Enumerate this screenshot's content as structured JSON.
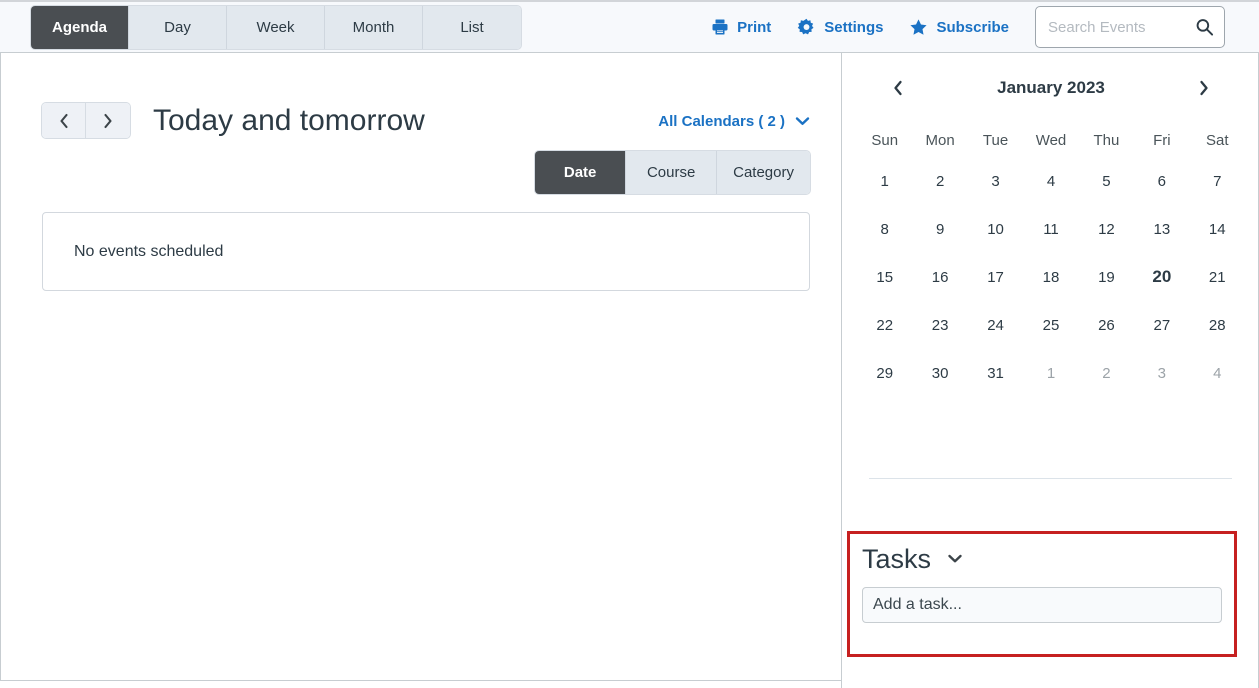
{
  "toolbar": {
    "view_tabs": [
      {
        "label": "Agenda",
        "active": true
      },
      {
        "label": "Day",
        "active": false
      },
      {
        "label": "Week",
        "active": false
      },
      {
        "label": "Month",
        "active": false
      },
      {
        "label": "List",
        "active": false
      }
    ],
    "actions": [
      {
        "label": "Print",
        "icon": "printer-icon"
      },
      {
        "label": "Settings",
        "icon": "gear-icon"
      },
      {
        "label": "Subscribe",
        "icon": "star-icon"
      }
    ],
    "search": {
      "placeholder": "Search Events",
      "value": "",
      "icon": "search-icon"
    }
  },
  "main": {
    "prev_label": "‹",
    "next_label": "›",
    "title": "Today and tomorrow",
    "calendars_link": "All Calendars ( 2 )",
    "filter_tabs": [
      {
        "label": "Date",
        "active": true
      },
      {
        "label": "Course",
        "active": false
      },
      {
        "label": "Category",
        "active": false
      }
    ],
    "empty_state": "No events scheduled"
  },
  "sidebar": {
    "mini_calendar": {
      "month_title": "January 2023",
      "prev_label": "‹",
      "next_label": "›",
      "weekdays": [
        "Sun",
        "Mon",
        "Tue",
        "Wed",
        "Thu",
        "Fri",
        "Sat"
      ],
      "days": [
        {
          "n": "1",
          "muted": false,
          "today": false
        },
        {
          "n": "2",
          "muted": false,
          "today": false
        },
        {
          "n": "3",
          "muted": false,
          "today": false
        },
        {
          "n": "4",
          "muted": false,
          "today": false
        },
        {
          "n": "5",
          "muted": false,
          "today": false
        },
        {
          "n": "6",
          "muted": false,
          "today": false
        },
        {
          "n": "7",
          "muted": false,
          "today": false
        },
        {
          "n": "8",
          "muted": false,
          "today": false
        },
        {
          "n": "9",
          "muted": false,
          "today": false
        },
        {
          "n": "10",
          "muted": false,
          "today": false
        },
        {
          "n": "11",
          "muted": false,
          "today": false
        },
        {
          "n": "12",
          "muted": false,
          "today": false
        },
        {
          "n": "13",
          "muted": false,
          "today": false
        },
        {
          "n": "14",
          "muted": false,
          "today": false
        },
        {
          "n": "15",
          "muted": false,
          "today": false
        },
        {
          "n": "16",
          "muted": false,
          "today": false
        },
        {
          "n": "17",
          "muted": false,
          "today": false
        },
        {
          "n": "18",
          "muted": false,
          "today": false
        },
        {
          "n": "19",
          "muted": false,
          "today": false
        },
        {
          "n": "20",
          "muted": false,
          "today": true
        },
        {
          "n": "21",
          "muted": false,
          "today": false
        },
        {
          "n": "22",
          "muted": false,
          "today": false
        },
        {
          "n": "23",
          "muted": false,
          "today": false
        },
        {
          "n": "24",
          "muted": false,
          "today": false
        },
        {
          "n": "25",
          "muted": false,
          "today": false
        },
        {
          "n": "26",
          "muted": false,
          "today": false
        },
        {
          "n": "27",
          "muted": false,
          "today": false
        },
        {
          "n": "28",
          "muted": false,
          "today": false
        },
        {
          "n": "29",
          "muted": false,
          "today": false
        },
        {
          "n": "30",
          "muted": false,
          "today": false
        },
        {
          "n": "31",
          "muted": false,
          "today": false
        },
        {
          "n": "1",
          "muted": true,
          "today": false
        },
        {
          "n": "2",
          "muted": true,
          "today": false
        },
        {
          "n": "3",
          "muted": true,
          "today": false
        },
        {
          "n": "4",
          "muted": true,
          "today": false
        }
      ]
    },
    "tasks": {
      "title": "Tasks",
      "toggle_icon": "chevron-down-icon",
      "input_placeholder": "Add a task...",
      "input_value": "",
      "highlight_color": "#C62020"
    }
  },
  "colors": {
    "accent_blue": "#1B72C4",
    "active_tab_bg": "#4A4E52",
    "inactive_tab_bg": "#E2E8EE",
    "text": "#2D3B45",
    "toolbar_bg": "#F7F9FC",
    "highlight_red": "#C62020"
  }
}
